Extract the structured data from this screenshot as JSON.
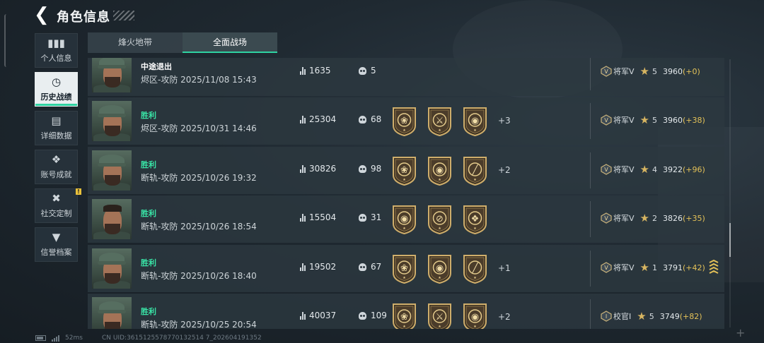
{
  "header": {
    "title": "角色信息",
    "back_icon": "back-arrow-icon"
  },
  "tabs": [
    {
      "label": "烽火地带",
      "active": false
    },
    {
      "label": "全面战场",
      "active": true
    }
  ],
  "sidebar": {
    "items": [
      {
        "label": "个人信息",
        "icon": "bar-chart-icon",
        "active": false
      },
      {
        "label": "历史战绩",
        "icon": "clock-icon",
        "active": true
      },
      {
        "label": "详细数据",
        "icon": "folder-icon",
        "active": false
      },
      {
        "label": "账号成就",
        "icon": "achievement-icon",
        "active": false
      },
      {
        "label": "社交定制",
        "icon": "tools-icon",
        "active": false,
        "notice": "!"
      },
      {
        "label": "信誉档案",
        "icon": "shield-icon",
        "active": false
      }
    ]
  },
  "matches": [
    {
      "result": "中途退出",
      "map": "烬区-攻防",
      "time": "2025/11/08 15:43",
      "score": "1635",
      "kills": "5",
      "badges": [],
      "extra": "",
      "rank": "将军V",
      "level": "5",
      "points": "3960",
      "delta": "(+0)"
    },
    {
      "result": "胜利",
      "map": "烬区-攻防",
      "time": "2025/10/31 14:46",
      "score": "25304",
      "kills": "68",
      "badges": [
        "rose",
        "axes",
        "skull-target"
      ],
      "extra": "+3",
      "rank": "将军V",
      "level": "5",
      "points": "3960",
      "delta": "(+38)"
    },
    {
      "result": "胜利",
      "map": "断轨-攻防",
      "time": "2025/10/26 19:32",
      "score": "30826",
      "kills": "98",
      "badges": [
        "rose",
        "skull-ring",
        "rifle"
      ],
      "extra": "+2",
      "rank": "将军V",
      "level": "4",
      "points": "3922",
      "delta": "(+96)"
    },
    {
      "result": "胜利",
      "map": "断轨-攻防",
      "time": "2025/10/26 18:54",
      "score": "15504",
      "kills": "31",
      "badges": [
        "skull-target",
        "rifle-ring",
        "skull-wings"
      ],
      "extra": "",
      "rank": "将军V",
      "level": "2",
      "points": "3826",
      "delta": "(+35)"
    },
    {
      "result": "胜利",
      "map": "断轨-攻防",
      "time": "2025/10/26 18:40",
      "score": "19502",
      "kills": "67",
      "badges": [
        "rose",
        "skull-ring",
        "rifle"
      ],
      "extra": "+1",
      "rank": "将军V",
      "level": "1",
      "points": "3791",
      "delta": "(+42)"
    },
    {
      "result": "胜利",
      "map": "断轨-攻防",
      "time": "2025/10/25 20:54",
      "score": "40037",
      "kills": "109",
      "badges": [
        "rose",
        "axes",
        "skull-target"
      ],
      "extra": "+2",
      "rank": "校官Ⅰ",
      "level": "5",
      "points": "3749",
      "delta": "(+82)"
    }
  ],
  "footer": {
    "ping": "52ms",
    "uid": "CN UID:3615125578770132514 7_202604191352"
  },
  "colors": {
    "accent": "#2fd3a2",
    "gold": "#d7b561",
    "victory": "#39e3a6"
  }
}
